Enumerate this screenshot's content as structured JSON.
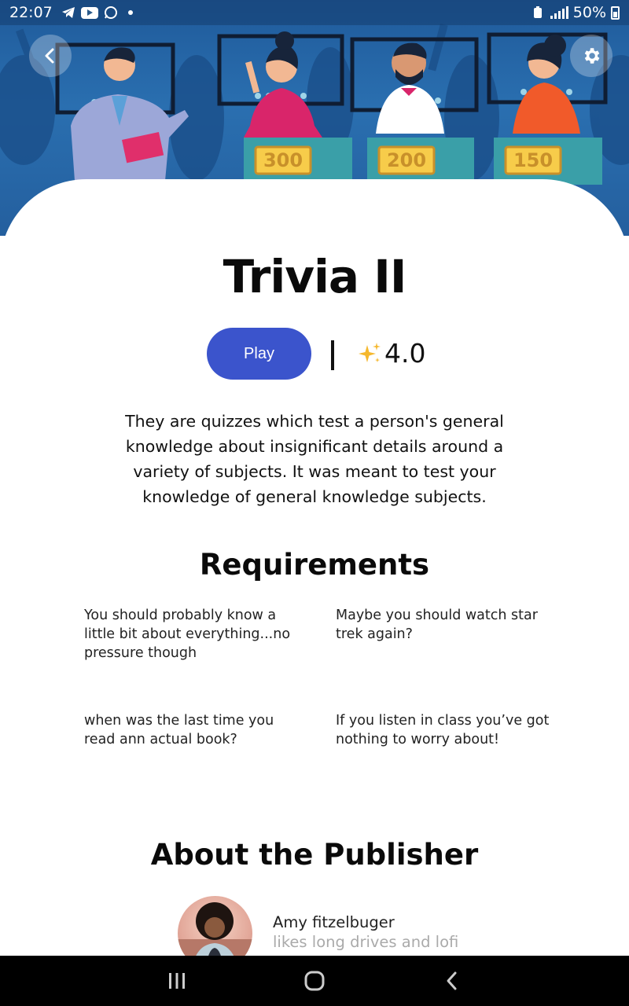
{
  "status_bar": {
    "time": "22:07",
    "battery": "50%",
    "icons": [
      "telegram-icon",
      "youtube-icon",
      "whatsapp-icon",
      "notification-dot",
      "battery-saver-icon",
      "signal-icon",
      "battery-icon"
    ]
  },
  "hero": {
    "podium_scores": [
      "300",
      "200",
      "150"
    ],
    "back_icon": "chevron-left-icon",
    "settings_icon": "gear-icon"
  },
  "game": {
    "title": "Trivia II",
    "play_label": "Play",
    "rating": "4.0",
    "rating_icon": "sparkles-icon",
    "description": "They are quizzes which test a person's general knowledge about insignificant details around a variety of subjects. It was meant to test your knowledge of general knowledge subjects."
  },
  "requirements": {
    "heading": "Requirements",
    "items": [
      "You should probably know a little bit about everything...no pressure though",
      "Maybe you should watch star trek again?",
      "when was the last time you read ann actual book?",
      "If you listen in class you’ve got nothing to worry about!"
    ]
  },
  "publisher": {
    "heading": "About the Publisher",
    "name": "Amy fitzelbuger",
    "bio": "likes long drives and lofi"
  },
  "colors": {
    "accent": "#3b54cc",
    "hero_blue": "#2a6fb0",
    "text": "#111111",
    "muted": "#aaaaaa"
  },
  "nav_bar": {
    "buttons": [
      "recent-apps-icon",
      "home-icon",
      "back-icon"
    ]
  }
}
